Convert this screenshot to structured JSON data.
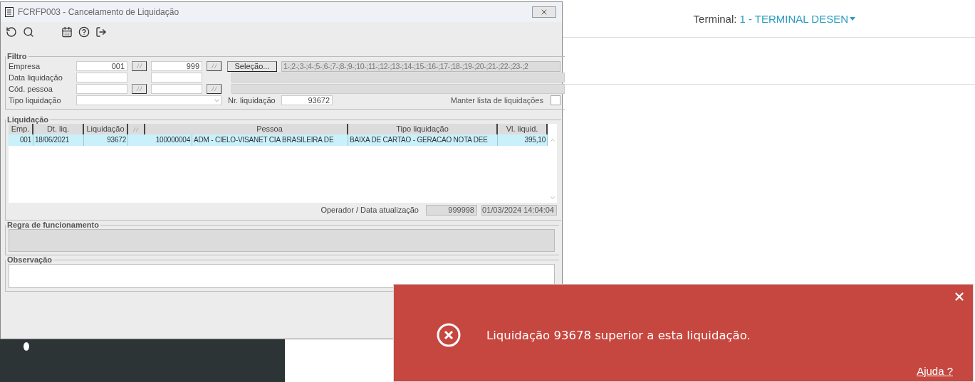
{
  "terminal": {
    "label": "Terminal:",
    "value": "1 - TERMINAL DESEN"
  },
  "window": {
    "title": "FCRFP003 - Cancelamento de Liquidação",
    "filter": {
      "title": "Filtro",
      "rows": [
        {
          "label": "Empresa",
          "from": "001",
          "to": "999",
          "lookup": true
        },
        {
          "label": "Data liquidação",
          "from": "",
          "to": "",
          "lookup": false
        },
        {
          "label": "Cód. pessoa",
          "from": "",
          "to": "",
          "lookup": true
        }
      ],
      "selection_button": "Seleção...",
      "selection_text": "1-;2-;3-;4-;5-;6-;7-;8-;9-;10-;11-;12-;13-;14-;15-;16-;17-;18-;19-;20-;21-;22-;23-;2",
      "type_label": "Tipo liquidação",
      "number_label": "Nr. liquidação",
      "number_value": "93672",
      "keep_list": {
        "label": "Manter lista de liquidações",
        "checked": false
      }
    },
    "liquidations": {
      "title": "Liquidação",
      "columns": [
        "Emp.",
        "Dt. liq.",
        "Liquidação",
        "",
        "Pessoa",
        "Tipo liquidação",
        "Vl. liquid."
      ],
      "rows": [
        {
          "selected": true,
          "cells": [
            "001",
            "18/06/2021",
            "93672",
            "100000004",
            "ADM - CIELO-VISANET CIA BRASILEIRA DE",
            "BAIXA DE CARTAO - GERACAO NOTA DEE",
            "395,10"
          ]
        }
      ],
      "operator_label": "Operador / Data atualização",
      "operator": "999998",
      "updated": "01/03/2024 14:04:04"
    },
    "rules": {
      "title": "Regra de funcionamento"
    },
    "notes": {
      "title": "Observação"
    }
  },
  "toast": {
    "message": "Liquidação 93678 superior a esta liquidação.",
    "help": "Ajuda ?"
  }
}
